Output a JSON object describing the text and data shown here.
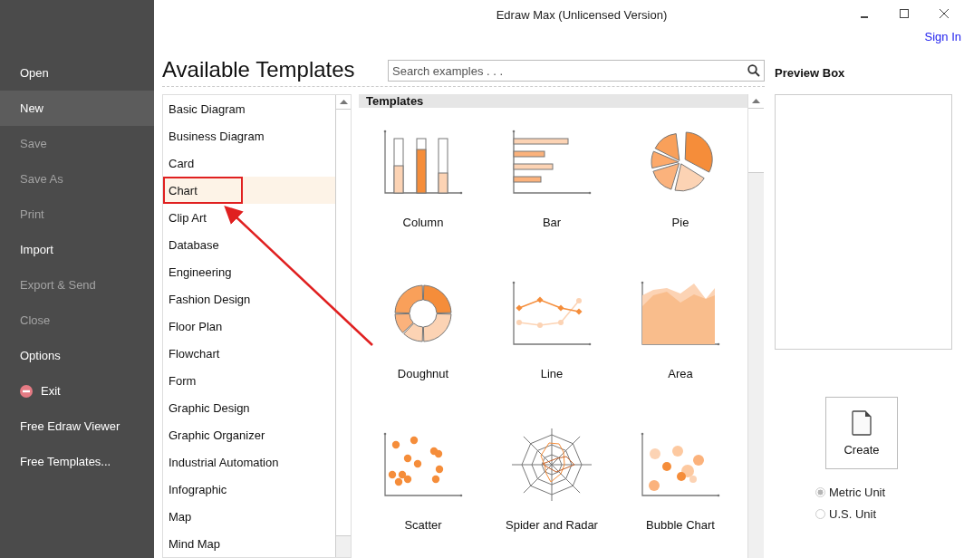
{
  "window": {
    "title": "Edraw Max (Unlicensed Version)"
  },
  "account": {
    "sign_in": "Sign In"
  },
  "menu": [
    {
      "label": "Open",
      "kind": "plain",
      "selected": false,
      "disabled": false
    },
    {
      "label": "New",
      "kind": "plain",
      "selected": true,
      "disabled": false
    },
    {
      "label": "Save",
      "kind": "plain",
      "selected": false,
      "disabled": true
    },
    {
      "label": "Save As",
      "kind": "plain",
      "selected": false,
      "disabled": true
    },
    {
      "label": "Print",
      "kind": "plain",
      "selected": false,
      "disabled": true
    },
    {
      "label": "Import",
      "kind": "plain",
      "selected": false,
      "disabled": false
    },
    {
      "label": "Export & Send",
      "kind": "plain",
      "selected": false,
      "disabled": true
    },
    {
      "label": "Close",
      "kind": "plain",
      "selected": false,
      "disabled": true
    },
    {
      "label": "Options",
      "kind": "plain",
      "selected": false,
      "disabled": false
    },
    {
      "label": "Exit",
      "kind": "exit",
      "selected": false,
      "disabled": false
    },
    {
      "label": "Free Edraw Viewer",
      "kind": "plain",
      "selected": false,
      "disabled": false
    },
    {
      "label": "Free Templates...",
      "kind": "plain",
      "selected": false,
      "disabled": false
    }
  ],
  "heading": "Available Templates",
  "search": {
    "placeholder": "Search examples . . ."
  },
  "categories": [
    {
      "label": "Basic Diagram",
      "selected": false,
      "callout": false
    },
    {
      "label": "Business Diagram",
      "selected": false,
      "callout": false
    },
    {
      "label": "Card",
      "selected": false,
      "callout": false
    },
    {
      "label": "Chart",
      "selected": true,
      "callout": true
    },
    {
      "label": "Clip Art",
      "selected": false,
      "callout": false
    },
    {
      "label": "Database",
      "selected": false,
      "callout": false
    },
    {
      "label": "Engineering",
      "selected": false,
      "callout": false
    },
    {
      "label": "Fashion Design",
      "selected": false,
      "callout": false
    },
    {
      "label": "Floor Plan",
      "selected": false,
      "callout": false
    },
    {
      "label": "Flowchart",
      "selected": false,
      "callout": false
    },
    {
      "label": "Form",
      "selected": false,
      "callout": false
    },
    {
      "label": "Graphic Design",
      "selected": false,
      "callout": false
    },
    {
      "label": "Graphic Organizer",
      "selected": false,
      "callout": false
    },
    {
      "label": "Industrial Automation",
      "selected": false,
      "callout": false
    },
    {
      "label": "Infographic",
      "selected": false,
      "callout": false
    },
    {
      "label": "Map",
      "selected": false,
      "callout": false
    },
    {
      "label": "Mind Map",
      "selected": false,
      "callout": false
    }
  ],
  "templates": {
    "header": "Templates",
    "items": [
      {
        "label": "Column",
        "kind": "column"
      },
      {
        "label": "Bar",
        "kind": "bar"
      },
      {
        "label": "Pie",
        "kind": "pie"
      },
      {
        "label": "Doughnut",
        "kind": "doughnut"
      },
      {
        "label": "Line",
        "kind": "line"
      },
      {
        "label": "Area",
        "kind": "area"
      },
      {
        "label": "Scatter",
        "kind": "scatter"
      },
      {
        "label": "Spider and Radar",
        "kind": "radar"
      },
      {
        "label": "Bubble Chart",
        "kind": "bubble"
      }
    ]
  },
  "preview": {
    "title": "Preview Box"
  },
  "create_button": "Create",
  "units": [
    {
      "label": "Metric Unit",
      "selected": true
    },
    {
      "label": "U.S. Unit",
      "selected": false
    }
  ]
}
